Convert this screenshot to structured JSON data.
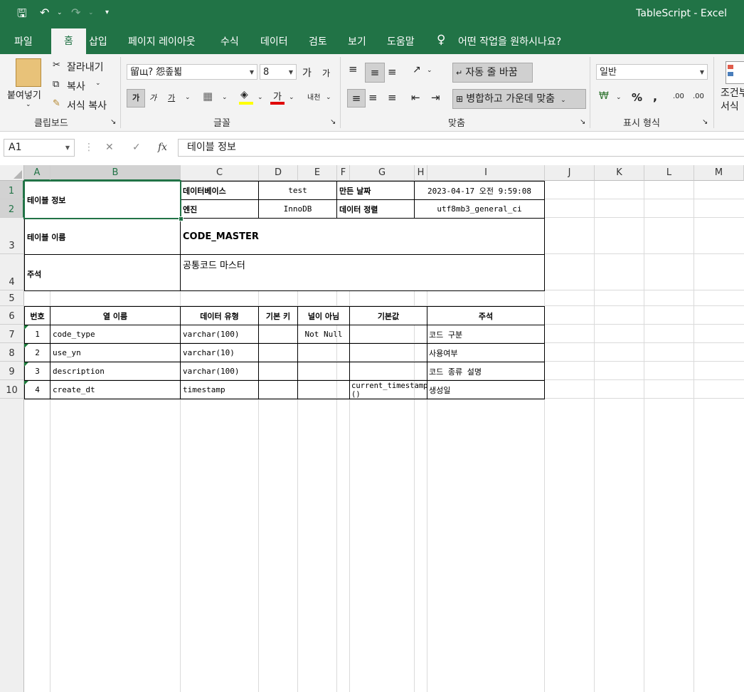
{
  "window": {
    "title": "TableScript  -  Excel"
  },
  "tabs": [
    "파일",
    "홈",
    "삽입",
    "페이지 레이아웃",
    "수식",
    "데이터",
    "검토",
    "보기",
    "도움말"
  ],
  "tell_me": "어떤 작업을 원하시나요?",
  "ribbon": {
    "clipboard": {
      "paste": "붙여넣기",
      "cut": "잘라내기",
      "copy": "복사",
      "format_painter": "서식 복사",
      "group": "클립보드"
    },
    "font": {
      "name": "留щ? 怨좊뵓",
      "size": "8",
      "bold": "가",
      "italic": "가",
      "underline": "가",
      "font_color": "가",
      "phonetic": "내천",
      "grow": "가",
      "shrink": "가",
      "group": "글꼴"
    },
    "alignment": {
      "wrap": "자동 줄 바꿈",
      "merge": "병합하고 가운데 맞춤",
      "group": "맞춤"
    },
    "number": {
      "format": "일반",
      "percent": "%",
      "comma": ",",
      "inc_dec": ".00",
      "group": "표시 형식"
    },
    "styles": {
      "conditional": "조건부 서식"
    }
  },
  "formula_bar": {
    "name_box": "A1",
    "fx": "fx",
    "cancel": "✕",
    "enter": "✓",
    "formula": "테이블 정보"
  },
  "columns": [
    "A",
    "B",
    "C",
    "D",
    "E",
    "F",
    "G",
    "H",
    "I",
    "J",
    "K",
    "L",
    "M"
  ],
  "rows": [
    "1",
    "2",
    "3",
    "4",
    "5",
    "6",
    "7",
    "8",
    "9",
    "10"
  ],
  "sheet": {
    "info": {
      "table_info": "테이블 정보",
      "database_label": "데이터베이스",
      "database_value": "test",
      "created_label": "만든 날짜",
      "created_value": "2023-04-17 오전 9:59:08",
      "engine_label": "엔진",
      "engine_value": "InnoDB",
      "collation_label": "데이터 정렬",
      "collation_value": "utf8mb3_general_ci",
      "table_name_label": "테이블 이름",
      "table_name_value": "CODE_MASTER",
      "comment_label": "주석",
      "comment_value": "공통코드 마스터"
    },
    "headers": [
      "번호",
      "열 이름",
      "데이터 유형",
      "기본 키",
      "널이 아님",
      "기본값",
      "주석"
    ],
    "rows": [
      {
        "no": "1",
        "name": "code_type",
        "type": "varchar(100)",
        "pk": "",
        "notnull": "Not Null",
        "default": "",
        "comment": "코드 구분"
      },
      {
        "no": "2",
        "name": "use_yn",
        "type": "varchar(10)",
        "pk": "",
        "notnull": "",
        "default": "",
        "comment": "사용여부"
      },
      {
        "no": "3",
        "name": "description",
        "type": "varchar(100)",
        "pk": "",
        "notnull": "",
        "default": "",
        "comment": "코드 종류 설명"
      },
      {
        "no": "4",
        "name": "create_dt",
        "type": "timestamp",
        "pk": "",
        "notnull": "",
        "default": "current_timestamp\n()",
        "comment": "생성일"
      }
    ]
  }
}
